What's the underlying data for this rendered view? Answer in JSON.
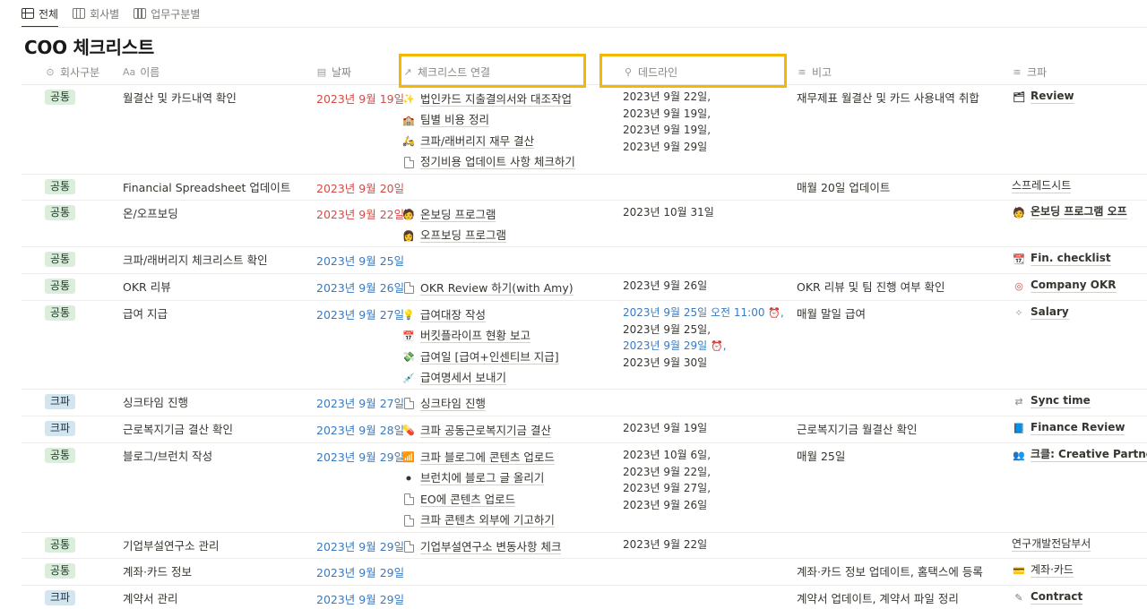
{
  "tabs": [
    {
      "label": "전체",
      "icon": "table-icon",
      "active": true
    },
    {
      "label": "회사별",
      "icon": "board-icon",
      "active": false
    },
    {
      "label": "업무구분별",
      "icon": "board-icon",
      "active": false
    }
  ],
  "title": "COO 체크리스트",
  "columns": [
    {
      "label": "회사구분",
      "icon": "select-icon"
    },
    {
      "label": "이름",
      "icon": "text-icon"
    },
    {
      "label": "날짜",
      "icon": "calendar-icon"
    },
    {
      "label": "체크리스트 연결",
      "icon": "relation-icon"
    },
    {
      "label": "데드라인",
      "icon": "search-icon"
    },
    {
      "label": "비고",
      "icon": "text-lines-icon"
    },
    {
      "label": "크파",
      "icon": "text-lines-icon"
    }
  ],
  "rows": [
    {
      "tag": "공통",
      "name": "월결산 및 카드내역 확인",
      "date": "2023년 9월 19일",
      "checklist": [
        {
          "icon": "sparkle",
          "label": "법인카드 지출결의서와 대조작업"
        },
        {
          "icon": "house",
          "label": "팀별 비용 정리"
        },
        {
          "icon": "car",
          "label": "크파/래버리지 재무 결산"
        },
        {
          "icon": "doc",
          "label": "정기비용 업데이트 사항 체크하기"
        }
      ],
      "deadline": [
        "2023년 9월 22일,",
        "2023년 9월 19일,",
        "2023년 9월 19일,",
        "2023년 9월 29일"
      ],
      "note": "재무제표 월결산 및 카드 사용내역 취합",
      "kp": "Review"
    },
    {
      "tag": "공통",
      "name": "Financial Spreadsheet 업데이트",
      "date": "2023년 9월 20일",
      "checklist": [],
      "deadline": [],
      "note": "매월 20일 업데이트",
      "kp": "스프레드시트"
    },
    {
      "tag": "공통",
      "name": "온/오프보딩",
      "date": "2023년 9월 22일",
      "checklist": [
        {
          "icon": "person",
          "label": "온보딩 프로그램"
        },
        {
          "icon": "person",
          "label": "오프보딩 프로그램"
        }
      ],
      "deadline": [
        "2023년 10월 31일"
      ],
      "note": "",
      "kp": "온보딩 프로그램  오프"
    },
    {
      "tag": "공통",
      "name": "크파/래버리지 체크리스트 확인",
      "date": "2023년 9월 25일",
      "checklist": [],
      "deadline": [],
      "note": "",
      "kp": "Fin. checklist"
    },
    {
      "tag": "공통",
      "name": "OKR 리뷰",
      "date": "2023년 9월 26일",
      "checklist": [
        {
          "icon": "doc",
          "label": "OKR Review 하기(with Amy)"
        }
      ],
      "deadline": [
        "2023년 9월 26일"
      ],
      "note": "OKR 리뷰 및 팀 진행 여부 확인",
      "kp": "Company OKR"
    },
    {
      "tag": "공통",
      "name": "급여 지급",
      "date": "2023년 9월 27일",
      "checklist": [
        {
          "icon": "bulb",
          "label": "급여대장 작성"
        },
        {
          "icon": "calendar",
          "label": "버킷플라이프 현황 보고"
        },
        {
          "icon": "money",
          "label": "급여일 [급여+인센티브 지급]"
        },
        {
          "icon": "syringe",
          "label": "급여명세서 보내기"
        }
      ],
      "deadline": [
        "2023년 9월 25일 오전 11:00",
        "2023년 9월 25일,",
        "2023년 9월 29일",
        "2023년 9월 30일"
      ],
      "note": "매월 말일 급여",
      "kp": "Salary"
    },
    {
      "tag": "크파",
      "name": "싱크타임 진행",
      "date": "2023년 9월 27일",
      "checklist": [
        {
          "icon": "doc",
          "label": "싱크타임 진행"
        }
      ],
      "deadline": [],
      "note": "",
      "kp": "Sync time"
    },
    {
      "tag": "크파",
      "name": "근로복지기금 결산 확인",
      "date": "2023년 9월 28일",
      "checklist": [
        {
          "icon": "pill",
          "label": "크파 공동근로복지기금 결산"
        }
      ],
      "deadline": [
        "2023년 9월 19일"
      ],
      "note": "근로복지기금 월결산 확인",
      "kp": "Finance Review"
    },
    {
      "tag": "공통",
      "name": "블로그/브런치 작성",
      "date": "2023년 9월 29일",
      "checklist": [
        {
          "icon": "wifi",
          "label": "크파 블로그에 콘텐츠 업로드"
        },
        {
          "icon": "circle",
          "label": "브런치에 블로그 글 올리기"
        },
        {
          "icon": "doc",
          "label": "EO에 콘텐츠 업로드"
        },
        {
          "icon": "doc",
          "label": "크파 콘텐츠 외부에 기고하기"
        }
      ],
      "deadline": [
        "2023년 10월 6일,",
        "2023년 9월 22일,",
        "2023년 9월 27일,",
        "2023년 9월 26일"
      ],
      "note": "매월 25일",
      "kp": "크클: Creative Partners W"
    },
    {
      "tag": "공통",
      "name": "기업부설연구소 관리",
      "date": "2023년 9월 29일",
      "checklist": [
        {
          "icon": "doc",
          "label": "기업부설연구소 변동사항 체크"
        }
      ],
      "deadline": [
        "2023년 9월 22일"
      ],
      "note": "",
      "kp": "연구개발전담부서"
    },
    {
      "tag": "공통",
      "name": "계좌·카드 정보",
      "date": "2023년 9월 29일",
      "checklist": [],
      "deadline": [],
      "note": "계좌·카드 정보 업데이트, 홈택스에 등록",
      "kp": "계좌·카드"
    },
    {
      "tag": "크파",
      "name": "계약서 관리",
      "date": "2023년 9월 29일",
      "checklist": [],
      "deadline": [],
      "note": "계약서 업데이트, 계약서 파일 정리",
      "kp": "Contract"
    }
  ],
  "colors": {
    "green_tag": "#dbeddb",
    "blue_tag": "#d3e5ef",
    "red_date": "#d44c47",
    "blue_date": "#3a7ac0",
    "highlight": "#f5b800"
  }
}
